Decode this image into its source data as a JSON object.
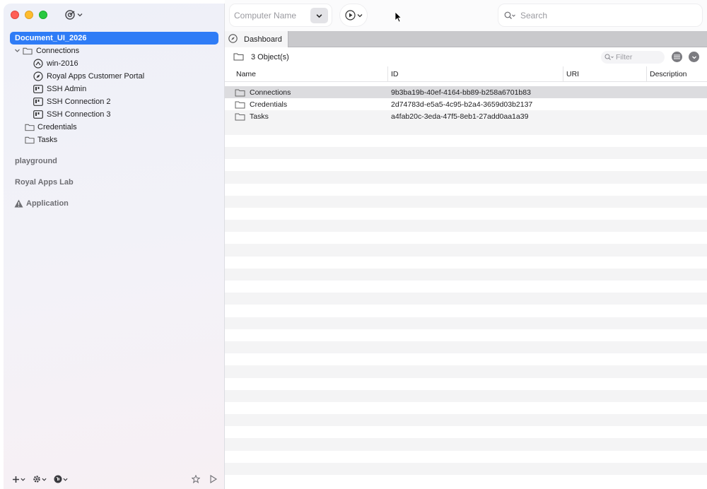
{
  "toolbar": {
    "computer_name_placeholder": "Computer Name",
    "search_placeholder": "Search"
  },
  "sidebar": {
    "document": "Document_UI_2026",
    "tree": [
      {
        "label": "Connections",
        "icon": "folder-icon",
        "level": 0,
        "expanded": true
      },
      {
        "label": "win-2016",
        "icon": "rdp-icon",
        "level": 1
      },
      {
        "label": "Royal Apps Customer Portal",
        "icon": "web-compass-icon",
        "level": 1
      },
      {
        "label": "SSH Admin",
        "icon": "terminal-icon",
        "level": 1
      },
      {
        "label": "SSH Connection 2",
        "icon": "terminal-icon",
        "level": 1
      },
      {
        "label": "SSH Connection 3",
        "icon": "terminal-icon",
        "level": 1
      },
      {
        "label": "Credentials",
        "icon": "folder-icon",
        "level": 0
      },
      {
        "label": "Tasks",
        "icon": "folder-icon",
        "level": 0
      }
    ],
    "sections": [
      "playground",
      "Royal Apps Lab"
    ],
    "application_label": "Application"
  },
  "tabs": [
    {
      "label": "Dashboard",
      "icon": "dashboard-compass-icon"
    }
  ],
  "objects": {
    "count_label": "3 Object(s)",
    "filter_placeholder": "Filter"
  },
  "table": {
    "columns": [
      "Name",
      "ID",
      "URI",
      "Description"
    ],
    "rows": [
      {
        "name": "Connections",
        "id": "9b3ba19b-40ef-4164-bb89-b258a6701b83",
        "uri": "",
        "description": ""
      },
      {
        "name": "Credentials",
        "id": "2d74783d-e5a5-4c95-b2a4-3659d03b2137",
        "uri": "",
        "description": ""
      },
      {
        "name": "Tasks",
        "id": "a4fab20c-3eda-47f5-8eb1-27add0aa1a39",
        "uri": "",
        "description": ""
      }
    ]
  },
  "colors": {
    "accent": "#2f7cf6",
    "row_stripe": "#f4f4f5",
    "row_selected": "#dcdcdf"
  }
}
